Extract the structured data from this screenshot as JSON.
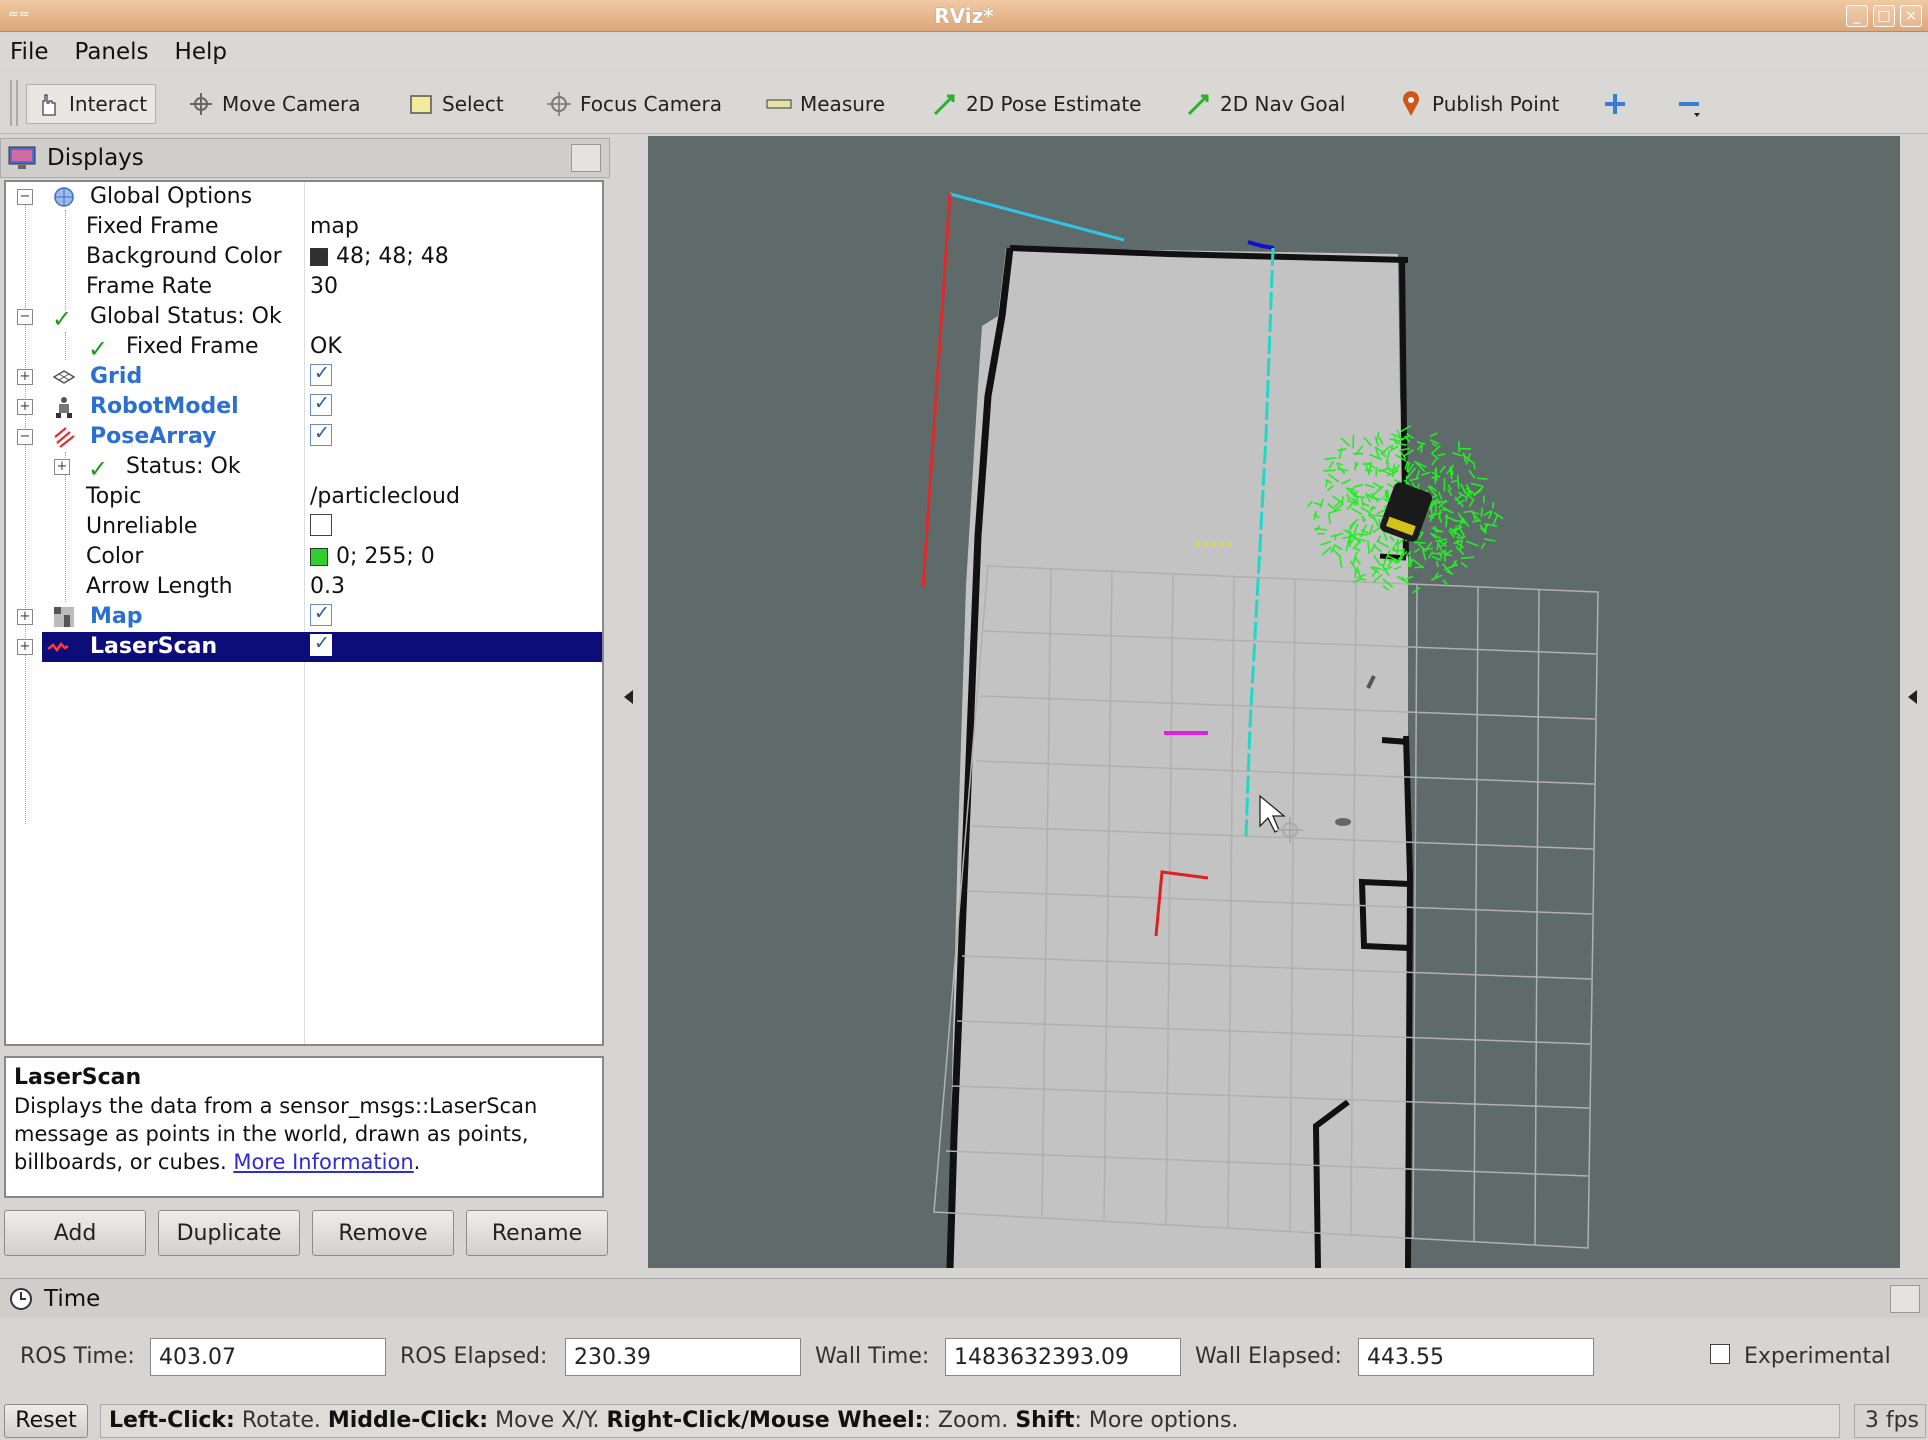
{
  "window": {
    "title": "RViz*"
  },
  "menu": {
    "file": "File",
    "panels": "Panels",
    "help": "Help"
  },
  "toolbar": {
    "interact": "Interact",
    "move_camera": "Move Camera",
    "select": "Select",
    "focus_camera": "Focus Camera",
    "measure": "Measure",
    "pose_estimate": "2D Pose Estimate",
    "nav_goal": "2D Nav Goal",
    "publish_point": "Publish Point"
  },
  "displays": {
    "title": "Displays",
    "rows": {
      "global_options": "Global Options",
      "fixed_frame": "Fixed Frame",
      "fixed_frame_val": "map",
      "bg_color": "Background Color",
      "bg_color_val": "48; 48; 48",
      "frame_rate": "Frame Rate",
      "frame_rate_val": "30",
      "global_status": "Global Status: Ok",
      "fixed_frame_status": "Fixed Frame",
      "fixed_frame_status_val": "OK",
      "grid": "Grid",
      "robot_model": "RobotModel",
      "pose_array": "PoseArray",
      "status_ok": "Status: Ok",
      "topic": "Topic",
      "topic_val": "/particlecloud",
      "unreliable": "Unreliable",
      "color": "Color",
      "color_val": "0; 255; 0",
      "arrow_length": "Arrow Length",
      "arrow_length_val": "0.3",
      "map": "Map",
      "laser_scan": "LaserScan"
    },
    "colors": {
      "background_swatch": "#303030",
      "particle_swatch": "#00ff00"
    }
  },
  "description": {
    "title": "LaserScan",
    "body": "Displays the data from a sensor_msgs::LaserScan message as points in the world, drawn as points, billboards, or cubes.",
    "link": "More Information"
  },
  "buttons": {
    "add": "Add",
    "duplicate": "Duplicate",
    "remove": "Remove",
    "rename": "Rename"
  },
  "time": {
    "title": "Time",
    "ros_time_label": "ROS Time:",
    "ros_time": "403.07",
    "ros_elapsed_label": "ROS Elapsed:",
    "ros_elapsed": "230.39",
    "wall_time_label": "Wall Time:",
    "wall_time": "1483632393.09",
    "wall_elapsed_label": "Wall Elapsed:",
    "wall_elapsed": "443.55",
    "experimental": "Experimental"
  },
  "status": {
    "reset": "Reset",
    "left_click": "Left-Click:",
    "rotate": " Rotate. ",
    "middle_click": "Middle-Click:",
    "move_xy": " Move X/Y. ",
    "right_click": "Right-Click/Mouse Wheel:",
    "zoom": ": Zoom. ",
    "shift": "Shift",
    "more": ": More options.",
    "fps": "3 fps"
  }
}
